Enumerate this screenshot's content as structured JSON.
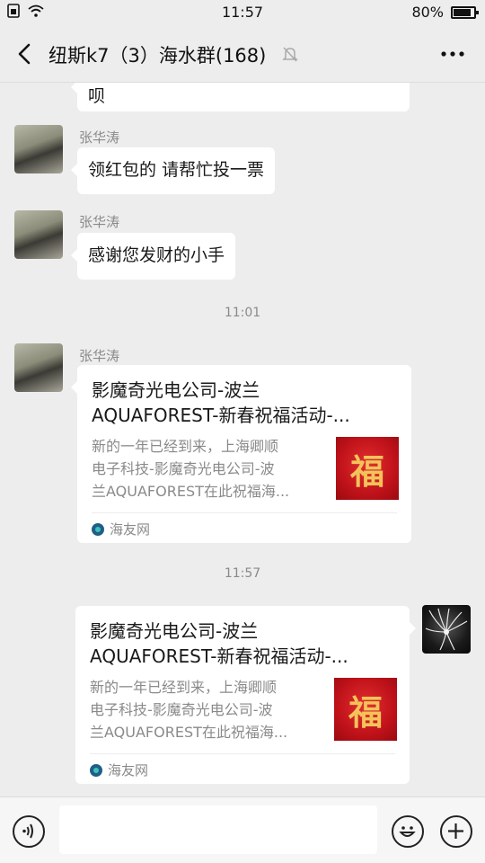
{
  "status_bar": {
    "time": "11:57",
    "battery_text": "80%"
  },
  "header": {
    "title": "纽斯k7（3）海水群(168)"
  },
  "messages": [
    {
      "type": "text",
      "side": "left",
      "text": "呗"
    },
    {
      "type": "text",
      "side": "left",
      "sender": "张华涛",
      "text": "领红包的 请帮忙投一票"
    },
    {
      "type": "text",
      "side": "left",
      "sender": "张华涛",
      "text": "感谢您发财的小手"
    },
    {
      "type": "time",
      "text": "11:01"
    },
    {
      "type": "link",
      "side": "left",
      "sender": "张华涛",
      "title_line1": "影魔奇光电公司-波兰",
      "title_line2": "AQUAFOREST-新春祝福活动-...",
      "desc_line1": "新的一年已经到来，上海卿顺",
      "desc_line2": "电子科技-影魔奇光电公司-波",
      "desc_line3": "兰AQUAFOREST在此祝福海...",
      "thumb_glyph": "福",
      "source": "海友网"
    },
    {
      "type": "time",
      "text": "11:57"
    },
    {
      "type": "link",
      "side": "right",
      "title_line1": "影魔奇光电公司-波兰",
      "title_line2": "AQUAFOREST-新春祝福活动-...",
      "desc_line1": "新的一年已经到来，上海卿顺",
      "desc_line2": "电子科技-影魔奇光电公司-波",
      "desc_line3": "兰AQUAFOREST在此祝福海...",
      "thumb_glyph": "福",
      "source": "海友网"
    }
  ],
  "colors": {
    "background": "#ededed",
    "bubble": "#ffffff",
    "secondary_text": "#8a8a8a",
    "thumb_red": "#c0121a",
    "thumb_gold": "#f3c35a"
  },
  "icons": [
    "sim-icon",
    "wifi-icon",
    "battery-icon",
    "back-icon",
    "mute-icon",
    "more-icon",
    "voice-icon",
    "emoji-icon",
    "plus-icon",
    "source-icon"
  ]
}
